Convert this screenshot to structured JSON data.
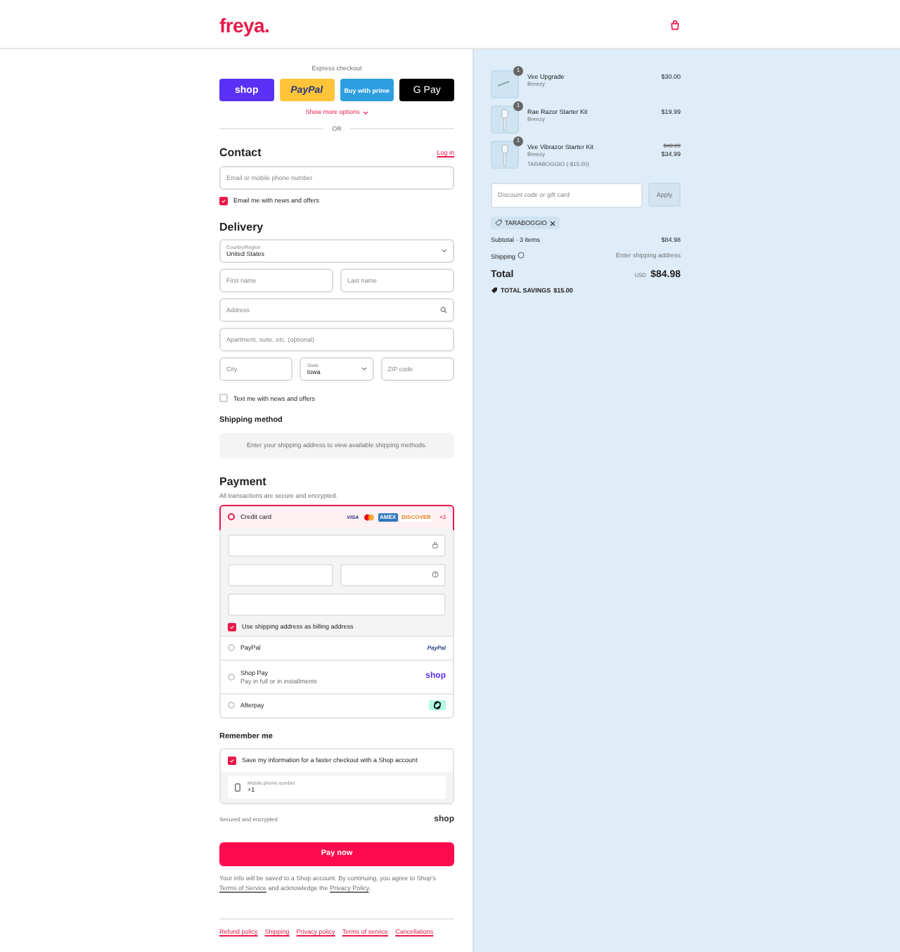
{
  "header": {
    "logo": "freya."
  },
  "express_checkout": {
    "label": "Express checkout",
    "buttons": [
      {
        "kind": "shop",
        "label": "shop"
      },
      {
        "kind": "paypal",
        "label": "PayPal"
      },
      {
        "kind": "amazon",
        "label": "Buy with prime"
      },
      {
        "kind": "gpay",
        "label": "G Pay"
      }
    ],
    "more_options": "Show more options",
    "divider": "OR"
  },
  "contact": {
    "title": "Contact",
    "login": "Log in",
    "email_placeholder": "Email or mobile phone number",
    "newsletter": {
      "label": "Email me with news and offers",
      "checked": true
    }
  },
  "delivery": {
    "title": "Delivery",
    "rows": [
      [
        {
          "kind": "select",
          "label": "Country/Region",
          "value": "United States"
        }
      ],
      [
        {
          "kind": "input",
          "placeholder": "First name"
        },
        {
          "kind": "input",
          "placeholder": "Last name"
        }
      ],
      [
        {
          "kind": "search",
          "placeholder": "Address"
        }
      ],
      [
        {
          "kind": "input",
          "placeholder": "Apartment, suite, etc. (optional)"
        }
      ],
      [
        {
          "kind": "input",
          "placeholder": "City"
        },
        {
          "kind": "select",
          "label": "State",
          "value": "Iowa"
        },
        {
          "kind": "input",
          "placeholder": "ZIP code"
        }
      ]
    ],
    "sms": {
      "label": "Text me with news and offers",
      "checked": false
    }
  },
  "shipping_method": {
    "title": "Shipping method",
    "notice": "Enter your shipping address to view available shipping methods."
  },
  "payment": {
    "title": "Payment",
    "subtitle": "All transactions are secure and encrypted.",
    "methods": [
      {
        "kind": "card",
        "label": "Credit card",
        "selected": true,
        "brands": [
          {
            "kind": "visa",
            "label": "VISA"
          },
          {
            "kind": "mastercard"
          },
          {
            "kind": "amex",
            "label": "AMEX"
          },
          {
            "kind": "discover",
            "label": "DISCOVER"
          }
        ],
        "more_brands": "+3",
        "billing": {
          "label": "Use shipping address as billing address",
          "checked": true
        }
      },
      {
        "kind": "paypal",
        "label": "PayPal",
        "selected": false,
        "logo": "PayPal"
      },
      {
        "kind": "shoppay",
        "label": "Shop Pay",
        "sublabel": "Pay in full or in installments",
        "selected": false,
        "logo": "shop"
      },
      {
        "kind": "afterpay",
        "label": "Afterpay",
        "selected": false
      }
    ]
  },
  "remember_me": {
    "title": "Remember me",
    "save": {
      "label": "Save my information for a faster checkout with a Shop account",
      "checked": true
    },
    "phone": {
      "label": "Mobile phone number",
      "value": "+1"
    },
    "secured": "Secured and encrypted",
    "shop_logo": "shop"
  },
  "pay_button": "Pay now",
  "terms": {
    "before": "Your info will be saved to a Shop account. By continuing, you agree to Shop's",
    "link1": "Terms of Service",
    "middle": "and acknowledge the",
    "link2": "Privacy Policy",
    "end": "."
  },
  "footer_links": [
    "Refund policy",
    "Shipping",
    "Privacy policy",
    "Terms of service",
    "Cancellations"
  ],
  "cart": {
    "items": [
      {
        "name": "Vee Upgrade",
        "vendor": "Breezy",
        "quantity": "1",
        "price": "$30.00"
      },
      {
        "name": "Rae Razor Starter Kit",
        "vendor": "Breezy",
        "quantity": "1",
        "price": "$19.99"
      },
      {
        "name": "Vee Vibrazor Starter Kit",
        "vendor": "Breezy",
        "quantity": "1",
        "original_price": "$49.99",
        "price": "$34.99",
        "discount": "TARABOGGIO (-$15.00)"
      }
    ],
    "discount_placeholder": "Discount code or gift card",
    "apply": "Apply",
    "applied_code": "TARABOGGIO",
    "subtotal_label": "Subtotal · 3 items",
    "subtotal": "$84.98",
    "shipping_label": "Shipping",
    "shipping_value": "Enter shipping address",
    "total_label": "Total",
    "currency": "USD",
    "total": "$84.98",
    "savings_label": "TOTAL SAVINGS",
    "savings": "$15.00"
  }
}
